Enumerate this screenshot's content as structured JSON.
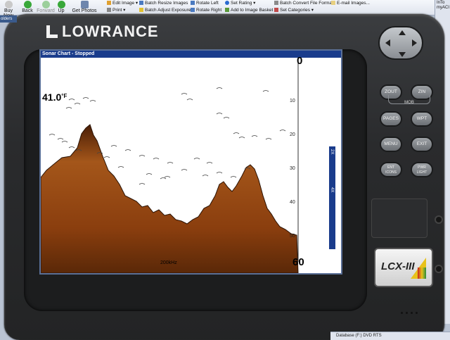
{
  "toolbar": {
    "buttons": [
      {
        "label": "Buy Now"
      },
      {
        "label": "Back"
      },
      {
        "label": "Forward"
      },
      {
        "label": "Up"
      },
      {
        "label": "Get Photos"
      }
    ],
    "menu": [
      {
        "label": "Edit Image"
      },
      {
        "label": "Print"
      },
      {
        "label": "Batch Resize Images"
      },
      {
        "label": "Batch Adjust Exposure"
      },
      {
        "label": "Rotate Left"
      },
      {
        "label": "Rotate Right"
      },
      {
        "label": "Set Rating"
      },
      {
        "label": "Add to Image Basket"
      },
      {
        "label": "Batch Convert File Format"
      },
      {
        "label": "Set Categories"
      },
      {
        "label": "E-mail Images..."
      }
    ],
    "right_panel": [
      "InTo",
      "myACI"
    ],
    "sidebar_label": "olders",
    "bottom_status": "Database  (F:)  DVD  RTS  "
  },
  "device": {
    "brand": "LOWRANCE",
    "model": "LCX-III",
    "buttons": [
      {
        "label": "ZOUT"
      },
      {
        "label": "ZIN"
      },
      {
        "label": "MOB"
      },
      {
        "label": "PAGES"
      },
      {
        "label": "WPT"
      },
      {
        "label": "MENU"
      },
      {
        "label": "EXIT"
      },
      {
        "label": "ENT",
        "sub": "ICONS"
      },
      {
        "label": "PWR",
        "sub": "LIGHT"
      }
    ]
  },
  "screen": {
    "title": "Sonar Chart - Stopped",
    "temperature": "41.0",
    "temperature_unit": "°F",
    "frequency": "200kHz",
    "depth_top": "0",
    "depth_bottom": "60",
    "depth_ticks": [
      "10",
      "20",
      "30",
      "40",
      "50"
    ],
    "zoom_labels": [
      "2X",
      "4X"
    ]
  },
  "colors": {
    "title_bar": "#1a3c8c",
    "bottom_echo": "#9a4a10",
    "zoom_bar": "#1a3c8c"
  }
}
